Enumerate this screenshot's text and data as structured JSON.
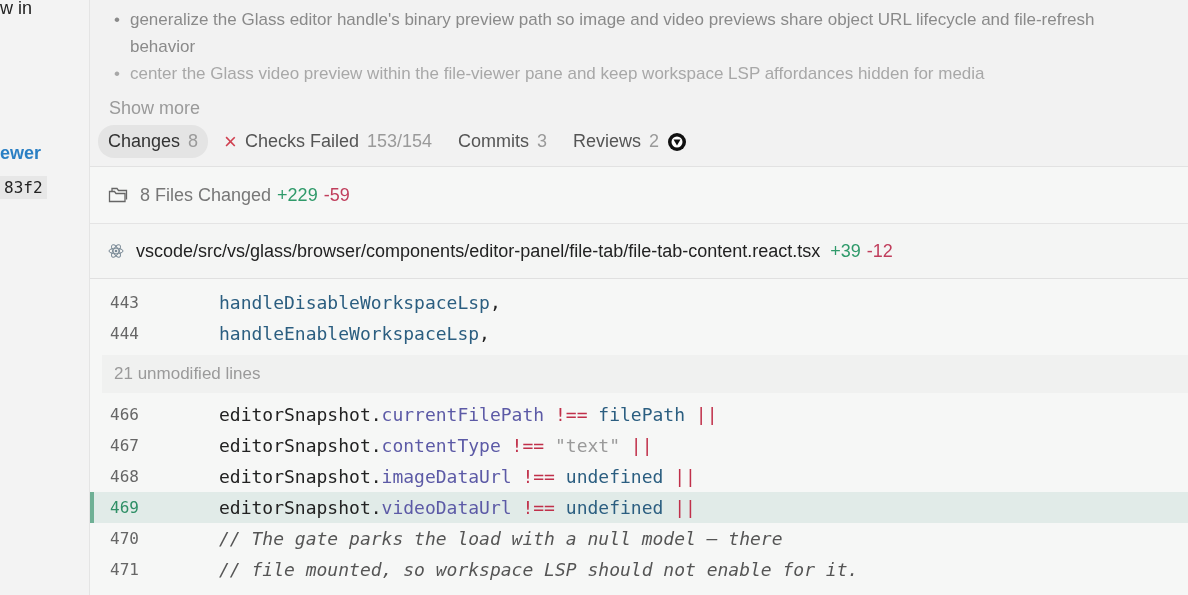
{
  "sidebar": {
    "texts": [
      {
        "text": "w in",
        "kind": "plain"
      },
      {
        "text": "ewer",
        "kind": "link"
      },
      {
        "text": "83f2",
        "kind": "code"
      }
    ]
  },
  "description": {
    "marker": "•",
    "bullets": [
      {
        "text": "generalize the Glass editor handle's binary preview path so image and video previews share object URL lifecycle and file-refresh behavior",
        "faded": false
      },
      {
        "text": "center the Glass video preview within the file-viewer pane and keep workspace LSP affordances hidden for media",
        "faded": true
      }
    ],
    "show_more": "Show more"
  },
  "tabs": [
    {
      "label": "Changes",
      "count": "8",
      "selected": true
    },
    {
      "label": "Checks Failed",
      "count": "153/154",
      "selected": false,
      "status_glyph": "×"
    },
    {
      "label": "Commits",
      "count": "3",
      "selected": false
    },
    {
      "label": "Reviews",
      "count": "2",
      "selected": false,
      "reviewer_avatar": true
    }
  ],
  "summary": {
    "label": "8 Files Changed",
    "added": "+229",
    "removed": "-59"
  },
  "file": {
    "path": "vscode/src/vs/glass/browser/components/editor-panel/file-tab/file-tab-content.react.tsx",
    "added": "+39",
    "removed": "-12"
  },
  "lines": [
    {
      "kind": "code",
      "number": "443",
      "highlighted": false,
      "tokens": [
        {
          "text": "handleDisableWorkspaceLsp",
          "kind": "ident"
        },
        {
          "text": ",",
          "kind": "plain"
        }
      ]
    },
    {
      "kind": "code",
      "number": "444",
      "highlighted": false,
      "tokens": [
        {
          "text": "handleEnableWorkspaceLsp",
          "kind": "ident"
        },
        {
          "text": ",",
          "kind": "plain"
        }
      ]
    },
    {
      "kind": "collapsed",
      "text": "21 unmodified lines"
    },
    {
      "kind": "code",
      "number": "466",
      "highlighted": false,
      "tokens": [
        {
          "text": "editorSnapshot.",
          "kind": "plain"
        },
        {
          "text": "currentFilePath",
          "kind": "prop"
        },
        {
          "text": " !== ",
          "kind": "op"
        },
        {
          "text": "filePath",
          "kind": "ident"
        },
        {
          "text": " ||",
          "kind": "op"
        }
      ]
    },
    {
      "kind": "code",
      "number": "467",
      "highlighted": false,
      "tokens": [
        {
          "text": "editorSnapshot.",
          "kind": "plain"
        },
        {
          "text": "contentType",
          "kind": "prop"
        },
        {
          "text": " !== ",
          "kind": "op"
        },
        {
          "text": "\"text\"",
          "kind": "string"
        },
        {
          "text": " ||",
          "kind": "op"
        }
      ]
    },
    {
      "kind": "code",
      "number": "468",
      "highlighted": false,
      "tokens": [
        {
          "text": "editorSnapshot.",
          "kind": "plain"
        },
        {
          "text": "imageDataUrl",
          "kind": "prop"
        },
        {
          "text": " !== ",
          "kind": "op"
        },
        {
          "text": "undefined",
          "kind": "ident"
        },
        {
          "text": " ||",
          "kind": "op"
        }
      ]
    },
    {
      "kind": "code",
      "number": "469",
      "highlighted": true,
      "tokens": [
        {
          "text": "editorSnapshot.",
          "kind": "plain"
        },
        {
          "text": "videoDataUrl",
          "kind": "prop"
        },
        {
          "text": " !== ",
          "kind": "op"
        },
        {
          "text": "undefined",
          "kind": "ident"
        },
        {
          "text": " ||",
          "kind": "op"
        }
      ]
    },
    {
      "kind": "code",
      "number": "470",
      "highlighted": false,
      "tokens": [
        {
          "text": "// The gate parks the load with a null model — there",
          "kind": "comment"
        }
      ]
    },
    {
      "kind": "code",
      "number": "471",
      "highlighted": false,
      "tokens": [
        {
          "text": "// file mounted, so workspace LSP should not enable for it.",
          "kind": "comment"
        }
      ]
    }
  ]
}
